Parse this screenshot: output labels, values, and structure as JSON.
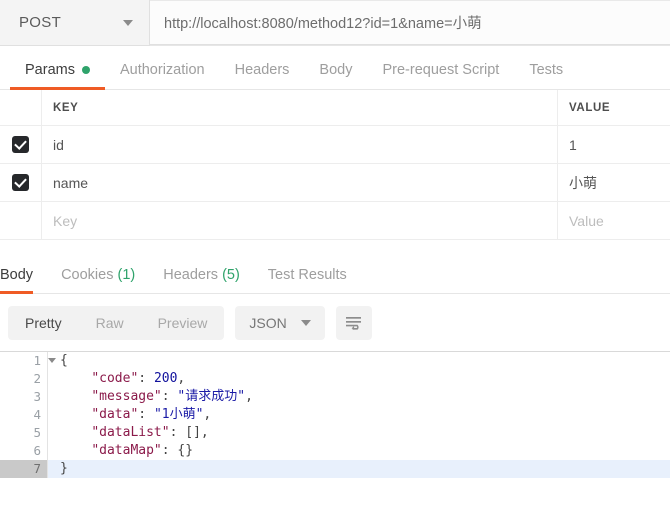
{
  "request": {
    "method": "POST",
    "url": "http://localhost:8080/method12?id=1&name=小萌",
    "method_caret_icon": "chevron-down-icon"
  },
  "request_tabs": [
    {
      "label": "Params",
      "active": true,
      "has_dot": true
    },
    {
      "label": "Authorization",
      "active": false,
      "has_dot": false
    },
    {
      "label": "Headers",
      "active": false,
      "has_dot": false
    },
    {
      "label": "Body",
      "active": false,
      "has_dot": false
    },
    {
      "label": "Pre-request Script",
      "active": false,
      "has_dot": false
    },
    {
      "label": "Tests",
      "active": false,
      "has_dot": false
    }
  ],
  "params_table": {
    "columns": {
      "key": "KEY",
      "value": "VALUE"
    },
    "rows": [
      {
        "checked": true,
        "key": "id",
        "value": "1",
        "placeholder": false
      },
      {
        "checked": true,
        "key": "name",
        "value": "小萌",
        "placeholder": false
      },
      {
        "checked": false,
        "key": "Key",
        "value": "Value",
        "placeholder": true
      }
    ]
  },
  "response_tabs": [
    {
      "label": "Body",
      "count": "",
      "active": true
    },
    {
      "label": "Cookies",
      "count": "(1)",
      "active": false
    },
    {
      "label": "Headers",
      "count": "(5)",
      "active": false
    },
    {
      "label": "Test Results",
      "count": "",
      "active": false
    }
  ],
  "format_toolbar": {
    "modes": [
      {
        "label": "Pretty",
        "active": true
      },
      {
        "label": "Raw",
        "active": false
      },
      {
        "label": "Preview",
        "active": false
      }
    ],
    "language": "JSON",
    "language_caret_icon": "chevron-down-icon",
    "wrap_icon": "word-wrap-icon"
  },
  "code": {
    "lines": [
      {
        "num": "1",
        "fold": true,
        "highlight": false,
        "tokens": [
          {
            "t": "p",
            "v": "{"
          }
        ]
      },
      {
        "num": "2",
        "fold": false,
        "highlight": false,
        "tokens": [
          {
            "t": "p",
            "v": "    "
          },
          {
            "t": "k",
            "v": "\"code\""
          },
          {
            "t": "p",
            "v": ": "
          },
          {
            "t": "n",
            "v": "200"
          },
          {
            "t": "p",
            "v": ","
          }
        ]
      },
      {
        "num": "3",
        "fold": false,
        "highlight": false,
        "tokens": [
          {
            "t": "p",
            "v": "    "
          },
          {
            "t": "k",
            "v": "\"message\""
          },
          {
            "t": "p",
            "v": ": "
          },
          {
            "t": "s",
            "v": "\"请求成功\""
          },
          {
            "t": "p",
            "v": ","
          }
        ]
      },
      {
        "num": "4",
        "fold": false,
        "highlight": false,
        "tokens": [
          {
            "t": "p",
            "v": "    "
          },
          {
            "t": "k",
            "v": "\"data\""
          },
          {
            "t": "p",
            "v": ": "
          },
          {
            "t": "s",
            "v": "\"1小萌\""
          },
          {
            "t": "p",
            "v": ","
          }
        ]
      },
      {
        "num": "5",
        "fold": false,
        "highlight": false,
        "tokens": [
          {
            "t": "p",
            "v": "    "
          },
          {
            "t": "k",
            "v": "\"dataList\""
          },
          {
            "t": "p",
            "v": ": [],"
          }
        ]
      },
      {
        "num": "6",
        "fold": false,
        "highlight": false,
        "tokens": [
          {
            "t": "p",
            "v": "    "
          },
          {
            "t": "k",
            "v": "\"dataMap\""
          },
          {
            "t": "p",
            "v": ": {}"
          }
        ]
      },
      {
        "num": "7",
        "fold": false,
        "highlight": true,
        "tokens": [
          {
            "t": "p",
            "v": "}"
          }
        ]
      }
    ]
  },
  "colors": {
    "accent_orange": "#ef5b25",
    "status_green": "#2fa36b",
    "json_key": "#8b1a4a",
    "json_string": "#1a1aa6",
    "json_number": "#11119c",
    "active_line": "#e8f0fc"
  }
}
